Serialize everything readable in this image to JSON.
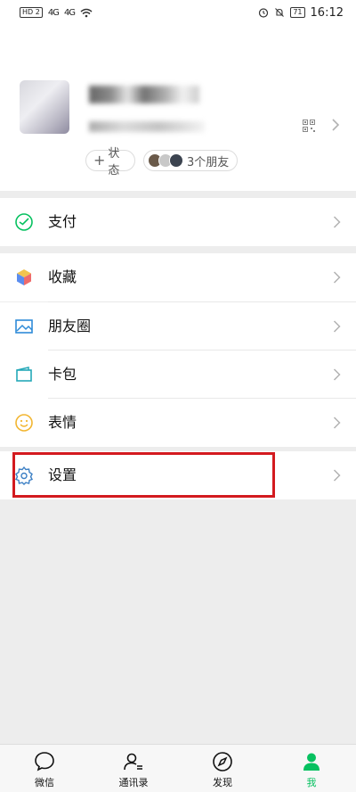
{
  "statusbar": {
    "hd": "HD 2",
    "sig1": "4G",
    "sig2": "4G",
    "battery": "71",
    "time": "16:12"
  },
  "profile": {
    "status_label": "状态",
    "friends_label": "3个朋友"
  },
  "menu": {
    "pay": "支付",
    "favorites": "收藏",
    "moments": "朋友圈",
    "cards": "卡包",
    "stickers": "表情",
    "settings": "设置"
  },
  "tabs": [
    {
      "label": "微信",
      "icon": "chat-icon"
    },
    {
      "label": "通讯录",
      "icon": "contacts-icon"
    },
    {
      "label": "发现",
      "icon": "compass-icon"
    },
    {
      "label": "我",
      "icon": "person-icon"
    }
  ],
  "colors": {
    "accent": "#07c160",
    "highlight": "#d31a1f",
    "background": "#ededed"
  }
}
